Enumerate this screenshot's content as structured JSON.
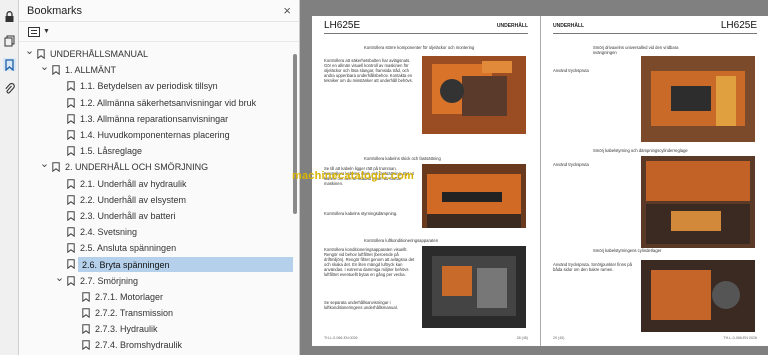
{
  "panel": {
    "title": "Bookmarks",
    "close_glyph": "×"
  },
  "bookmarks": [
    {
      "label": "UNDERHÅLLSMANUAL",
      "level": 0,
      "expanded": true
    },
    {
      "label": "1. ALLMÄNT",
      "level": 1,
      "expanded": true
    },
    {
      "label": "1.1. Betydelsen av periodisk tillsyn",
      "level": 2
    },
    {
      "label": "1.2. Allmänna säkerhetsanvisningar vid bruk",
      "level": 2
    },
    {
      "label": "1.3. Allmänna reparationsanvisningar",
      "level": 2
    },
    {
      "label": "1.4. Huvudkomponenternas placering",
      "level": 2
    },
    {
      "label": "1.5. Låsreglage",
      "level": 2
    },
    {
      "label": "2. UNDERHÅLL OCH SMÖRJNING",
      "level": 1,
      "expanded": true
    },
    {
      "label": "2.1. Underhåll av hydraulik",
      "level": 2
    },
    {
      "label": "2.2. Underhåll av elsystem",
      "level": 2
    },
    {
      "label": "2.3. Underhåll av batteri",
      "level": 2
    },
    {
      "label": "2.4. Svetsning",
      "level": 2
    },
    {
      "label": "2.5. Ansluta spänningen",
      "level": 2
    },
    {
      "label": "2.6. Bryta spänningen",
      "level": 2,
      "selected": true
    },
    {
      "label": "2.7. Smörjning",
      "level": 2,
      "expanded": true
    },
    {
      "label": "2.7.1. Motorlager",
      "level": 3
    },
    {
      "label": "2.7.2. Transmission",
      "level": 3
    },
    {
      "label": "2.7.3. Hydraulik",
      "level": 3
    },
    {
      "label": "2.7.4. Bromshydraulik",
      "level": 3
    }
  ],
  "document": {
    "left_page": {
      "model": "LH625E",
      "section": "UNDERHÅLL",
      "bullets": [
        "Kontrollera större komponenter för oljeläckor och montering",
        "Kontrollera kabelns skick och fastsättning",
        "Kontrollera luftkonditioneringsapparaten"
      ],
      "para1": "Kontrollera att säkerhetsbulten har avlägsnats. Gör en allmän visuell kontroll av maskinen för oljeläckor och lösa slangar, framsida tråd, och andra uppenbara underhållsbehov. Kontakta en tekniker om du misstänker att underhåll behövs.",
      "para2": "Se till att kabeln ligger rätt på trumman. Kontrollera kabelns skick och fastsättning. Byt ut kabeln om den är skadad innan du startar maskinen.",
      "para3": "Kontrollera kabelns styrningsdämpning.",
      "para4": "Kontrollera konditioneringsapparaten visuellt. Rengör vid behov luftfiltret (beroende på driftmiljön). Rengör filtret genom att avlägsna det och skaka det. En liten mängd luftryck kan användas. I extrema dammiga miljöer behövs luftfiltret eventuellt bytas en gång per vecka.",
      "para5": "Se separata underhållsanvisningar i luftkonditioneringens underhållsmanual.",
      "footer_left": "TH-L-0-066-EN 0026",
      "footer_right": "28 (45)"
    },
    "right_page": {
      "model": "LH625E",
      "section": "UNDERHÅLL",
      "bullets": [
        "Smörj drivaxelns universalled vid den vridbara svängningen",
        "Smörj kabelstyrning och dämpningscylinderreglage",
        "Smörj kabelstyrningens cylinderlager"
      ],
      "note1": "Använd tryckspruta",
      "note2": "Använd tryckspruta",
      "note3": "Använd tryckspruta. Smörjpunkter finns på båda sidor om den bakre ramen.",
      "footer_left": "29 (45)",
      "footer_right": "TH-L-0-066-EN 0026"
    },
    "watermark": "machinecatalogic.com"
  },
  "colors": {
    "selection": "#b5d0ea",
    "photo_orange": "#c8651f",
    "viewer_bg": "#808080"
  }
}
